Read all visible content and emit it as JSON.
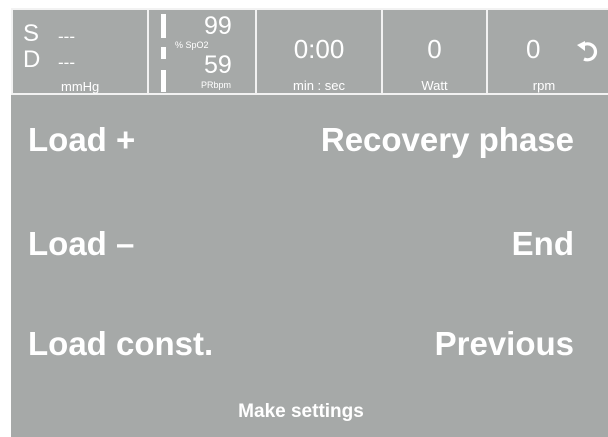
{
  "status": {
    "bp": {
      "s_label": "S",
      "s_value": "---",
      "d_label": "D",
      "d_value": "---",
      "unit": "mmHg"
    },
    "spo2": {
      "spo2_value": "99",
      "spo2_label": "% SpO2",
      "pr_value": "59",
      "pr_label": "PRbpm"
    },
    "time": {
      "value": "0:00",
      "unit": "min : sec"
    },
    "watt": {
      "value": "0",
      "unit": "Watt"
    },
    "rpm": {
      "value": "0",
      "unit": "rpm",
      "icon": "rotate-icon"
    }
  },
  "menu": {
    "load_plus": "Load +",
    "recovery_phase": "Recovery phase",
    "load_minus": "Load –",
    "end": "End",
    "load_const": "Load const.",
    "previous": "Previous"
  },
  "footer": {
    "make_settings": "Make settings"
  },
  "colors": {
    "background": "#a6a9a8",
    "text": "#ffffff"
  }
}
